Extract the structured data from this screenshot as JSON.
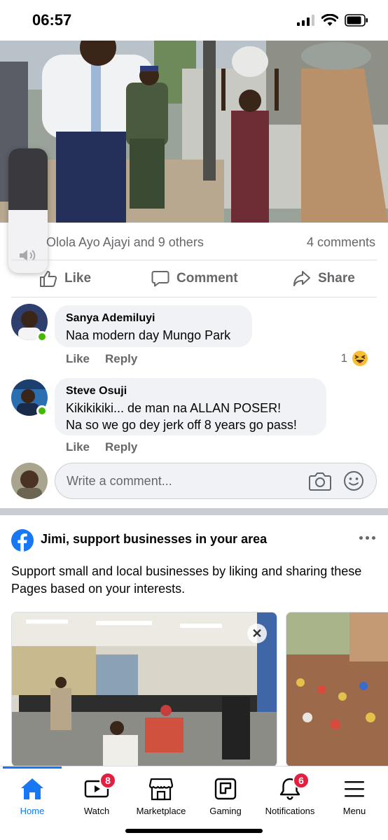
{
  "status_bar": {
    "time": "06:57"
  },
  "post": {
    "reactions_text": "Olola Ayo Ajayi and 9 others",
    "comments_count": "4 comments",
    "actions": {
      "like": "Like",
      "comment": "Comment",
      "share": "Share"
    }
  },
  "comments": [
    {
      "author": "Sanya Ademiluyi",
      "text": "Naa modern day Mungo Park",
      "like_label": "Like",
      "reply_label": "Reply",
      "reaction_count": "1",
      "reaction_emoji": "😆"
    },
    {
      "author": "Steve Osuji",
      "text_line1": "Kikikikiki... de man na ALLAN POSER!",
      "text_line2": "Na so we go dey jerk off 8 years go pass!",
      "like_label": "Like",
      "reply_label": "Reply"
    }
  ],
  "write_comment": {
    "placeholder": "Write a comment..."
  },
  "suggestions": {
    "title": "Jimi, support businesses in your area",
    "description": "Support small and local businesses by liking and sharing these Pages based on your interests.",
    "close_symbol": "✕"
  },
  "bottom_nav": {
    "items": [
      {
        "label": "Home",
        "active": true
      },
      {
        "label": "Watch",
        "badge": "8"
      },
      {
        "label": "Marketplace"
      },
      {
        "label": "Gaming"
      },
      {
        "label": "Notifications",
        "badge": "6"
      },
      {
        "label": "Menu"
      }
    ]
  },
  "colors": {
    "accent": "#1877f2",
    "badge": "#e41e3f",
    "online": "#44b700"
  }
}
